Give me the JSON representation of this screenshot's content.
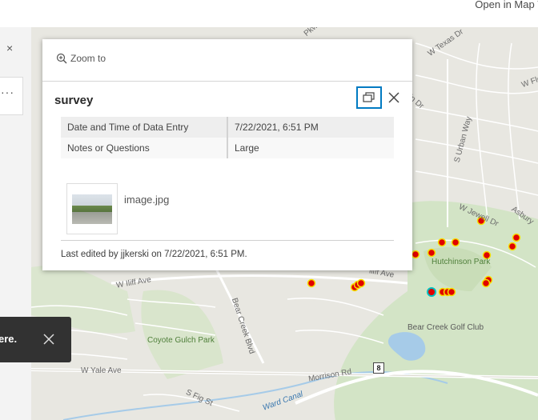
{
  "header": {
    "open_in_map_viewer": "Open in Map V"
  },
  "left_panel": {
    "close_glyph": "×",
    "more_glyph": "···"
  },
  "map": {
    "labels": {
      "w_texas_dr": "W Texas Dr",
      "w_florida": "W Flori",
      "s_urban_way": "S Urban Way",
      "w_jewell_dr": "W Jewell Dr",
      "asbury": "Asbury",
      "hutchinson_park": "Hutchinson Park",
      "w_iliff_ave": "W Iliff Ave",
      "iliff_ave": "lliff Ave",
      "bear_creek_blvd": "Bear Creek Blvd",
      "coyote_gulch_park": "Coyote Gulch Park",
      "bear_creek_golf_club": "Bear Creek Golf Club",
      "w_yale_ave": "W Yale Ave",
      "morrison_rd": "Morrison Rd",
      "s_fig_st": "S Fig St",
      "ward_canal": "Ward Canal",
      "road_fragment_pkw": "Pkw",
      "road_fragment_in": "in Dr",
      "route_8": "8"
    }
  },
  "popup": {
    "zoom_to_label": "Zoom to",
    "title": "survey",
    "fields": [
      {
        "name": "Date and Time of Data Entry",
        "value": "7/22/2021, 6:51 PM"
      },
      {
        "name": "Notes or Questions",
        "value": "Large"
      }
    ],
    "attachment_name": "image.jpg",
    "last_edited": "Last edited by jjkerski on 7/22/2021, 6:51 PM."
  },
  "toast": {
    "text": "ere."
  },
  "colors": {
    "accent": "#007ac2",
    "point_fill": "#e00000",
    "point_stroke": "#f5e000",
    "selected_ring": "#00c0c0"
  }
}
